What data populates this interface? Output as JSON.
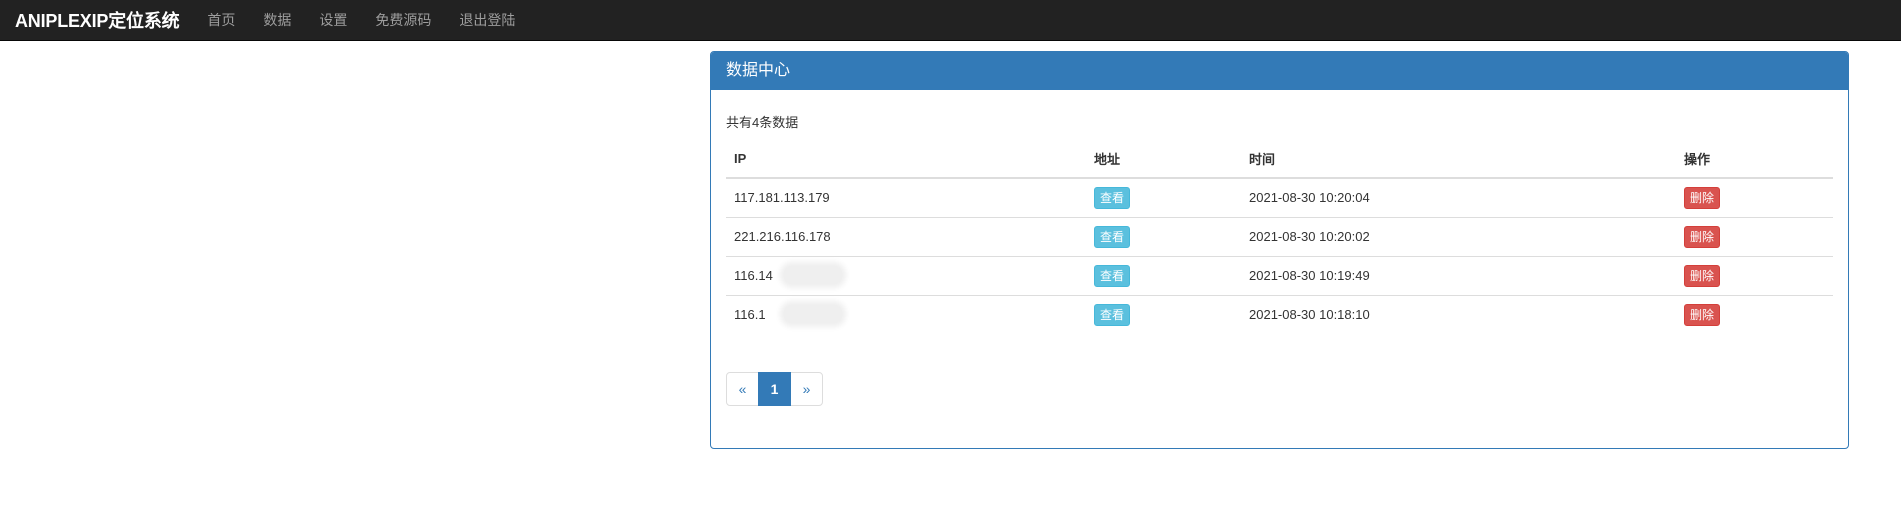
{
  "navbar": {
    "brand": "ANIPLEXIP定位系统",
    "links": [
      {
        "label": "首页"
      },
      {
        "label": "数据"
      },
      {
        "label": "设置"
      },
      {
        "label": "免费源码"
      },
      {
        "label": "退出登陆"
      }
    ]
  },
  "panel": {
    "title": "数据中心",
    "count_text": "共有4条数据",
    "columns": [
      "IP",
      "地址",
      "时间",
      "操作"
    ],
    "rows": [
      {
        "ip": "117.181.113.179",
        "ip_masked": false,
        "view_label": "查看",
        "time": "2021-08-30 10:20:04",
        "delete_label": "删除"
      },
      {
        "ip": "221.216.116.178",
        "ip_masked": false,
        "view_label": "查看",
        "time": "2021-08-30 10:20:02",
        "delete_label": "删除"
      },
      {
        "ip": "116.14",
        "ip_masked": true,
        "view_label": "查看",
        "time": "2021-08-30 10:19:49",
        "delete_label": "删除"
      },
      {
        "ip": "116.1",
        "ip_masked": true,
        "view_label": "查看",
        "time": "2021-08-30 10:18:10",
        "delete_label": "删除"
      }
    ],
    "pagination": {
      "prev": "«",
      "current": "1",
      "next": "»"
    }
  },
  "colors": {
    "navbar_bg": "#222222",
    "primary": "#337ab7",
    "info": "#5bc0de",
    "danger": "#d9534f"
  }
}
